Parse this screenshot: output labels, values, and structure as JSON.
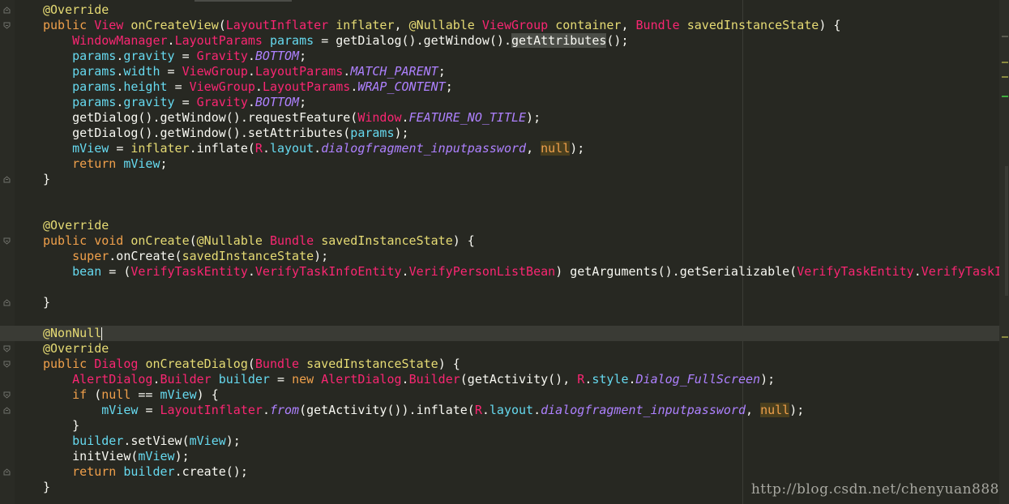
{
  "editor": {
    "watermark": "http://blog.csdn.net/chenyuan888",
    "colors": {
      "background": "#272822",
      "keyword": "#f0a04b",
      "type": "#f92672",
      "method": "#e6db74",
      "field": "#66d9ef",
      "constant": "#ae81ff"
    },
    "lines": [
      [
        [
          "c-annot",
          "@Override"
        ]
      ],
      [
        [
          "c-kw",
          "public "
        ],
        [
          "c-type",
          "View "
        ],
        [
          "c-method",
          "onCreateView"
        ],
        [
          "c-default",
          "("
        ],
        [
          "c-type",
          "LayoutInflater "
        ],
        [
          "c-method",
          "inflater"
        ],
        [
          "c-default",
          ", "
        ],
        [
          "c-annot",
          "@Nullable "
        ],
        [
          "c-type",
          "ViewGroup "
        ],
        [
          "c-method",
          "container"
        ],
        [
          "c-default",
          ", "
        ],
        [
          "c-type",
          "Bundle "
        ],
        [
          "c-method",
          "savedInstanceState"
        ],
        [
          "c-default",
          ") {"
        ]
      ],
      [
        [
          "c-default",
          "    "
        ],
        [
          "c-type",
          "WindowManager"
        ],
        [
          "c-default",
          "."
        ],
        [
          "c-type",
          "LayoutParams "
        ],
        [
          "c-field",
          "params "
        ],
        [
          "c-default",
          "= getDialog().getWindow()."
        ],
        [
          "c-hl",
          "getAttributes"
        ],
        [
          "c-default",
          "();"
        ]
      ],
      [
        [
          "c-default",
          "    "
        ],
        [
          "c-field",
          "params"
        ],
        [
          "c-default",
          "."
        ],
        [
          "c-field",
          "gravity "
        ],
        [
          "c-default",
          "= "
        ],
        [
          "c-type",
          "Gravity"
        ],
        [
          "c-default",
          "."
        ],
        [
          "c-const",
          "BOTTOM"
        ],
        [
          "c-default",
          ";"
        ]
      ],
      [
        [
          "c-default",
          "    "
        ],
        [
          "c-field",
          "params"
        ],
        [
          "c-default",
          "."
        ],
        [
          "c-field",
          "width "
        ],
        [
          "c-default",
          "= "
        ],
        [
          "c-type",
          "ViewGroup"
        ],
        [
          "c-default",
          "."
        ],
        [
          "c-type",
          "LayoutParams"
        ],
        [
          "c-default",
          "."
        ],
        [
          "c-const",
          "MATCH_PARENT"
        ],
        [
          "c-default",
          ";"
        ]
      ],
      [
        [
          "c-default",
          "    "
        ],
        [
          "c-field",
          "params"
        ],
        [
          "c-default",
          "."
        ],
        [
          "c-field",
          "height "
        ],
        [
          "c-default",
          "= "
        ],
        [
          "c-type",
          "ViewGroup"
        ],
        [
          "c-default",
          "."
        ],
        [
          "c-type",
          "LayoutParams"
        ],
        [
          "c-default",
          "."
        ],
        [
          "c-const",
          "WRAP_CONTENT"
        ],
        [
          "c-default",
          ";"
        ]
      ],
      [
        [
          "c-default",
          "    "
        ],
        [
          "c-field",
          "params"
        ],
        [
          "c-default",
          "."
        ],
        [
          "c-field",
          "gravity "
        ],
        [
          "c-default",
          "= "
        ],
        [
          "c-type",
          "Gravity"
        ],
        [
          "c-default",
          "."
        ],
        [
          "c-const",
          "BOTTOM"
        ],
        [
          "c-default",
          ";"
        ]
      ],
      [
        [
          "c-default",
          "    getDialog().getWindow().requestFeature("
        ],
        [
          "c-type",
          "Window"
        ],
        [
          "c-default",
          "."
        ],
        [
          "c-const",
          "FEATURE_NO_TITLE"
        ],
        [
          "c-default",
          ");"
        ]
      ],
      [
        [
          "c-default",
          "    getDialog().getWindow().setAttributes("
        ],
        [
          "c-field",
          "params"
        ],
        [
          "c-default",
          ");"
        ]
      ],
      [
        [
          "c-default",
          "    "
        ],
        [
          "c-field",
          "mView "
        ],
        [
          "c-default",
          "= "
        ],
        [
          "c-method",
          "inflater"
        ],
        [
          "c-default",
          ".inflate("
        ],
        [
          "c-type",
          "R"
        ],
        [
          "c-default",
          "."
        ],
        [
          "c-field",
          "layout"
        ],
        [
          "c-default",
          "."
        ],
        [
          "c-const",
          "dialogfragment_inputpassword"
        ],
        [
          "c-default",
          ", "
        ],
        [
          "c-null",
          "null"
        ],
        [
          "c-default",
          ");"
        ]
      ],
      [
        [
          "c-default",
          "    "
        ],
        [
          "c-kw",
          "return "
        ],
        [
          "c-field",
          "mView"
        ],
        [
          "c-default",
          ";"
        ]
      ],
      [
        [
          "c-default",
          "}"
        ]
      ],
      [],
      [],
      [
        [
          "c-annot",
          "@Override"
        ]
      ],
      [
        [
          "c-kw",
          "public void "
        ],
        [
          "c-method",
          "onCreate"
        ],
        [
          "c-default",
          "("
        ],
        [
          "c-annot",
          "@Nullable "
        ],
        [
          "c-type",
          "Bundle "
        ],
        [
          "c-method",
          "savedInstanceState"
        ],
        [
          "c-default",
          ") {"
        ]
      ],
      [
        [
          "c-default",
          "    "
        ],
        [
          "c-kw",
          "super"
        ],
        [
          "c-default",
          ".onCreate("
        ],
        [
          "c-method",
          "savedInstanceState"
        ],
        [
          "c-default",
          ");"
        ]
      ],
      [
        [
          "c-default",
          "    "
        ],
        [
          "c-field",
          "bean "
        ],
        [
          "c-default",
          "= ("
        ],
        [
          "c-type",
          "VerifyTaskEntity"
        ],
        [
          "c-default",
          "."
        ],
        [
          "c-type",
          "VerifyTaskInfoEntity"
        ],
        [
          "c-default",
          "."
        ],
        [
          "c-type",
          "VerifyPersonListBean"
        ],
        [
          "c-default",
          ") getArguments().getSerializable("
        ],
        [
          "c-type",
          "VerifyTaskEntity"
        ],
        [
          "c-default",
          "."
        ],
        [
          "c-type",
          "VerifyTaskInfo"
        ]
      ],
      [],
      [
        [
          "c-default",
          "}"
        ]
      ],
      [],
      [
        [
          "c-annot",
          "@NonNull"
        ]
      ],
      [
        [
          "c-annot",
          "@Override"
        ]
      ],
      [
        [
          "c-kw",
          "public "
        ],
        [
          "c-type",
          "Dialog "
        ],
        [
          "c-method",
          "onCreateDialog"
        ],
        [
          "c-default",
          "("
        ],
        [
          "c-type",
          "Bundle "
        ],
        [
          "c-method",
          "savedInstanceState"
        ],
        [
          "c-default",
          ") {"
        ]
      ],
      [
        [
          "c-default",
          "    "
        ],
        [
          "c-type",
          "AlertDialog"
        ],
        [
          "c-default",
          "."
        ],
        [
          "c-type",
          "Builder "
        ],
        [
          "c-field",
          "builder "
        ],
        [
          "c-default",
          "= "
        ],
        [
          "c-kw",
          "new "
        ],
        [
          "c-type",
          "AlertDialog"
        ],
        [
          "c-default",
          "."
        ],
        [
          "c-type",
          "Builder"
        ],
        [
          "c-default",
          "(getActivity(), "
        ],
        [
          "c-type",
          "R"
        ],
        [
          "c-default",
          "."
        ],
        [
          "c-field",
          "style"
        ],
        [
          "c-default",
          "."
        ],
        [
          "c-const",
          "Dialog_FullScreen"
        ],
        [
          "c-default",
          ");"
        ]
      ],
      [
        [
          "c-default",
          "    "
        ],
        [
          "c-kw",
          "if "
        ],
        [
          "c-default",
          "("
        ],
        [
          "c-kw",
          "null "
        ],
        [
          "c-default",
          "== "
        ],
        [
          "c-field",
          "mView"
        ],
        [
          "c-default",
          ") {"
        ]
      ],
      [
        [
          "c-default",
          "        "
        ],
        [
          "c-field",
          "mView "
        ],
        [
          "c-default",
          "= "
        ],
        [
          "c-type",
          "LayoutInflater"
        ],
        [
          "c-default",
          "."
        ],
        [
          "c-const",
          "from"
        ],
        [
          "c-default",
          "(getActivity()).inflate("
        ],
        [
          "c-type",
          "R"
        ],
        [
          "c-default",
          "."
        ],
        [
          "c-field",
          "layout"
        ],
        [
          "c-default",
          "."
        ],
        [
          "c-const",
          "dialogfragment_inputpassword"
        ],
        [
          "c-default",
          ", "
        ],
        [
          "c-null",
          "null"
        ],
        [
          "c-default",
          ");"
        ]
      ],
      [
        [
          "c-default",
          "    }"
        ]
      ],
      [
        [
          "c-default",
          "    "
        ],
        [
          "c-field",
          "builder"
        ],
        [
          "c-default",
          ".setView("
        ],
        [
          "c-field",
          "mView"
        ],
        [
          "c-default",
          ");"
        ]
      ],
      [
        [
          "c-default",
          "    initView("
        ],
        [
          "c-field",
          "mView"
        ],
        [
          "c-default",
          ");"
        ]
      ],
      [
        [
          "c-default",
          "    "
        ],
        [
          "c-kw",
          "return "
        ],
        [
          "c-field",
          "builder"
        ],
        [
          "c-default",
          ".create();"
        ]
      ],
      [
        [
          "c-default",
          "}"
        ]
      ]
    ]
  }
}
